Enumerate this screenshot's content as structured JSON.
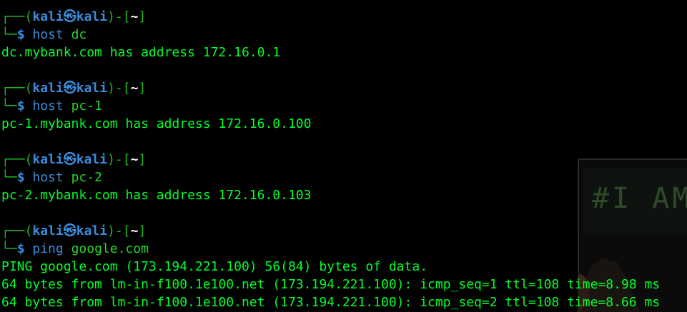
{
  "prompt": {
    "frame_top": "┌──(",
    "user": "kali",
    "at_icon": "㉿",
    "host": "kali",
    "dir_open": ")-[",
    "dir": "~",
    "dir_close": "]",
    "frame_bottom": "└─",
    "symbol": "$"
  },
  "blocks": [
    {
      "cmd": "host",
      "arg": "dc",
      "output": [
        "dc.mybank.com has address 172.16.0.1"
      ]
    },
    {
      "cmd": "host",
      "arg": "pc-1",
      "output": [
        "pc-1.mybank.com has address 172.16.0.100"
      ]
    },
    {
      "cmd": "host",
      "arg": "pc-2",
      "output": [
        "pc-2.mybank.com has address 172.16.0.103"
      ]
    },
    {
      "cmd": "ping",
      "arg": "google.com",
      "output": [
        "PING google.com (173.194.221.100) 56(84) bytes of data.",
        "64 bytes from lm-in-f100.1e100.net (173.194.221.100): icmp_seq=1 ttl=108 time=8.98 ms",
        "64 bytes from lm-in-f100.1e100.net (173.194.221.100): icmp_seq=2 ttl=108 time=8.66 ms"
      ]
    }
  ],
  "wallpaper": {
    "text": "#I AM"
  },
  "colors": {
    "background": "#000000",
    "prompt_frame": "#1fb81f",
    "prompt_user": "#3a8ddc",
    "command": "#3a8ddc",
    "argument": "#28d628",
    "output": "#00ff2a"
  }
}
